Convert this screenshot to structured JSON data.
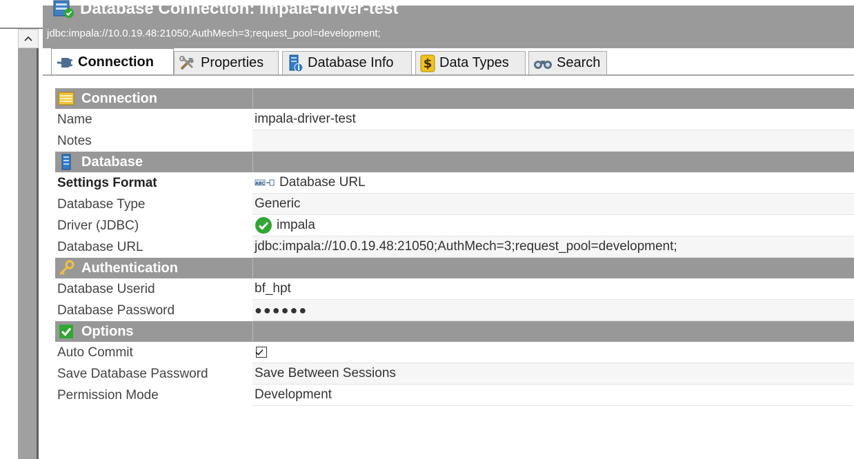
{
  "header": {
    "title": "Database Connection: impala-driver-test",
    "url": "jdbc:impala://10.0.19.48:21050;AuthMech=3;request_pool=development;"
  },
  "tabs": [
    {
      "label": "Connection",
      "icon": "plug-icon"
    },
    {
      "label": "Properties",
      "icon": "tools-icon"
    },
    {
      "label": "Database Info",
      "icon": "database-info-icon"
    },
    {
      "label": "Data Types",
      "icon": "dollar-icon"
    },
    {
      "label": "Search",
      "icon": "binoculars-icon"
    }
  ],
  "sections": {
    "connection": {
      "title": "Connection",
      "rows": [
        {
          "label": "Name",
          "value": "impala-driver-test"
        },
        {
          "label": "Notes",
          "value": ""
        }
      ]
    },
    "database": {
      "title": "Database",
      "rows": [
        {
          "label": "Settings Format",
          "value": "Database URL"
        },
        {
          "label": "Database Type",
          "value": "Generic"
        },
        {
          "label": "Driver (JDBC)",
          "value": "impala"
        },
        {
          "label": "Database URL",
          "value": "jdbc:impala://10.0.19.48:21050;AuthMech=3;request_pool=development;"
        }
      ]
    },
    "authentication": {
      "title": "Authentication",
      "rows": [
        {
          "label": "Database Userid",
          "value": "bf_hpt"
        },
        {
          "label": "Database Password",
          "value": "●●●●●●"
        }
      ]
    },
    "options": {
      "title": "Options",
      "rows": [
        {
          "label": "Auto Commit",
          "checked": true
        },
        {
          "label": "Save Database Password",
          "value": "Save Between Sessions"
        },
        {
          "label": "Permission Mode",
          "value": "Development"
        }
      ]
    }
  },
  "colors": {
    "header_bg": "#9a9a9a",
    "section_bg": "#989898",
    "check_green": "#2fa832"
  }
}
